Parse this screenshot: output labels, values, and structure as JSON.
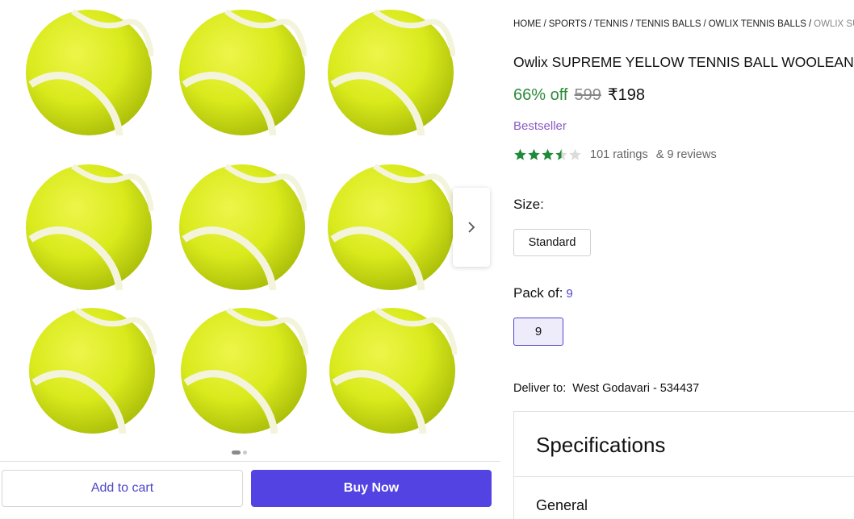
{
  "breadcrumb": [
    {
      "label": "HOME"
    },
    {
      "label": "SPORTS"
    },
    {
      "label": "TENNIS"
    },
    {
      "label": "TENNIS BALLS"
    },
    {
      "label": "OWLIX TENNIS BALLS"
    },
    {
      "label": "OWLIX SUP",
      "current": true
    }
  ],
  "product": {
    "title": "Owlix SUPREME YELLOW TENNIS BALL WOOLEAN",
    "discount": "66% off",
    "mrp": "599",
    "price": "₹198",
    "badge": "Bestseller",
    "rating_value": 3.5,
    "ratings_text": "101 ratings",
    "reviews_text": "& 9 reviews"
  },
  "size": {
    "label": "Size:",
    "option": "Standard"
  },
  "pack": {
    "label": "Pack of:",
    "value": "9",
    "option": "9"
  },
  "delivery": {
    "label": "Deliver to:",
    "location": "West Godavari - 534437"
  },
  "specifications": {
    "title": "Specifications",
    "section": "General"
  },
  "gallery": {
    "image_count": 2,
    "active_index": 0
  },
  "actions": {
    "add_to_cart": "Add to cart",
    "buy_now": "Buy Now"
  },
  "colors": {
    "accent": "#5243e2",
    "discount": "#2e8a3b",
    "star": "#1f8a3a",
    "ball": "#d9ea1c"
  }
}
